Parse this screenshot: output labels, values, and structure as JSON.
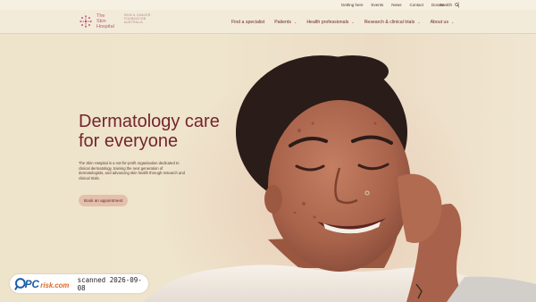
{
  "utility_nav": {
    "links": [
      "Getting here",
      "Events",
      "News",
      "Contact",
      "Donate"
    ],
    "search_label": "Search"
  },
  "header": {
    "logo_line1": "The",
    "logo_line2": "Skin",
    "logo_line3": "Hospital",
    "tagline_line1": "SKIN & CANCER",
    "tagline_line2": "FOUNDATION",
    "tagline_line3": "AUSTRALIA",
    "nav": [
      {
        "label": "Find a specialist",
        "has_menu": false
      },
      {
        "label": "Patients",
        "has_menu": true
      },
      {
        "label": "Health professionals",
        "has_menu": true
      },
      {
        "label": "Research & clinical trials",
        "has_menu": true
      },
      {
        "label": "About us",
        "has_menu": true
      }
    ]
  },
  "hero": {
    "headline_line1": "Dermatology care",
    "headline_line2": "for everyone",
    "body": "The Skin Hospital is a not-for-profit organisation dedicated to clinical dermatology, training the next generation of dermatologists, and advancing skin health through research and clinical trials.",
    "cta_label": "Book an appointment"
  },
  "watermark": {
    "brand_pc": "PC",
    "brand_risk": "risk.com",
    "stamp": "scanned 2026-09-08"
  },
  "colors": {
    "brand": "#74252c",
    "accent": "#e4c0ac",
    "background": "#efe5cf"
  }
}
